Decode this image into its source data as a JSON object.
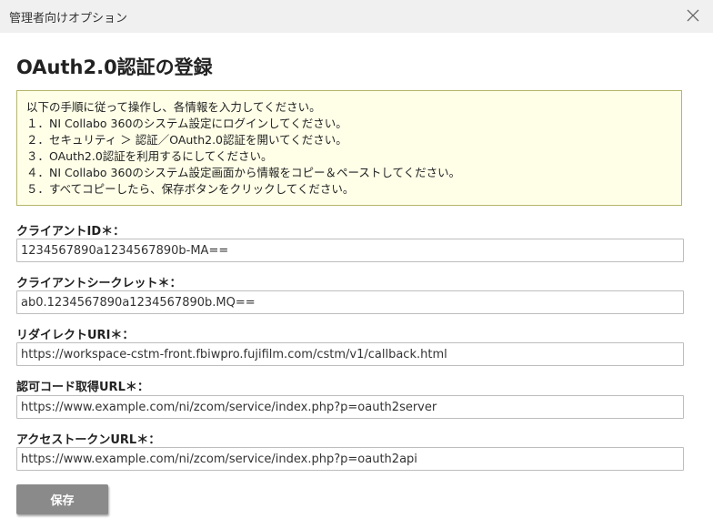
{
  "window": {
    "title": "管理者向けオプション"
  },
  "page": {
    "heading": "OAuth2.0認証の登録"
  },
  "instructions": {
    "lines": [
      "以下の手順に従って操作し、各情報を入力してください。",
      "１．NI Collabo 360のシステム設定にログインしてください。",
      "２．セキュリティ ＞ 認証／OAuth2.0認証を開いてください。",
      "３．OAuth2.0認証を利用するにしてください。",
      "４．NI Collabo 360のシステム設定画面から情報をコピー＆ペーストしてください。",
      "５．すべてコピーしたら、保存ボタンをクリックしてください。"
    ]
  },
  "fields": {
    "client_id": {
      "label": "クライアントID＊：",
      "value": "1234567890a1234567890b-MA=="
    },
    "client_secret": {
      "label": "クライアントシークレット＊：",
      "value": "ab0.1234567890a1234567890b.MQ=="
    },
    "redirect_uri": {
      "label": "リダイレクトURI＊：",
      "value": "https://workspace-cstm-front.fbiwpro.fujifilm.com/cstm/v1/callback.html"
    },
    "auth_code_url": {
      "label": "認可コード取得URL＊：",
      "value": "https://www.example.com/ni/zcom/service/index.php?p=oauth2server"
    },
    "access_token_url": {
      "label": "アクセストークンURL＊：",
      "value": "https://www.example.com/ni/zcom/service/index.php?p=oauth2api"
    }
  },
  "actions": {
    "save_label": "保存"
  },
  "icons": {
    "close": "close-icon"
  },
  "colors": {
    "titlebar_bg": "#f0f0f0",
    "info_bg": "#ffffe8",
    "info_border": "#b5b56b",
    "button_bg": "#8a8a8a"
  }
}
